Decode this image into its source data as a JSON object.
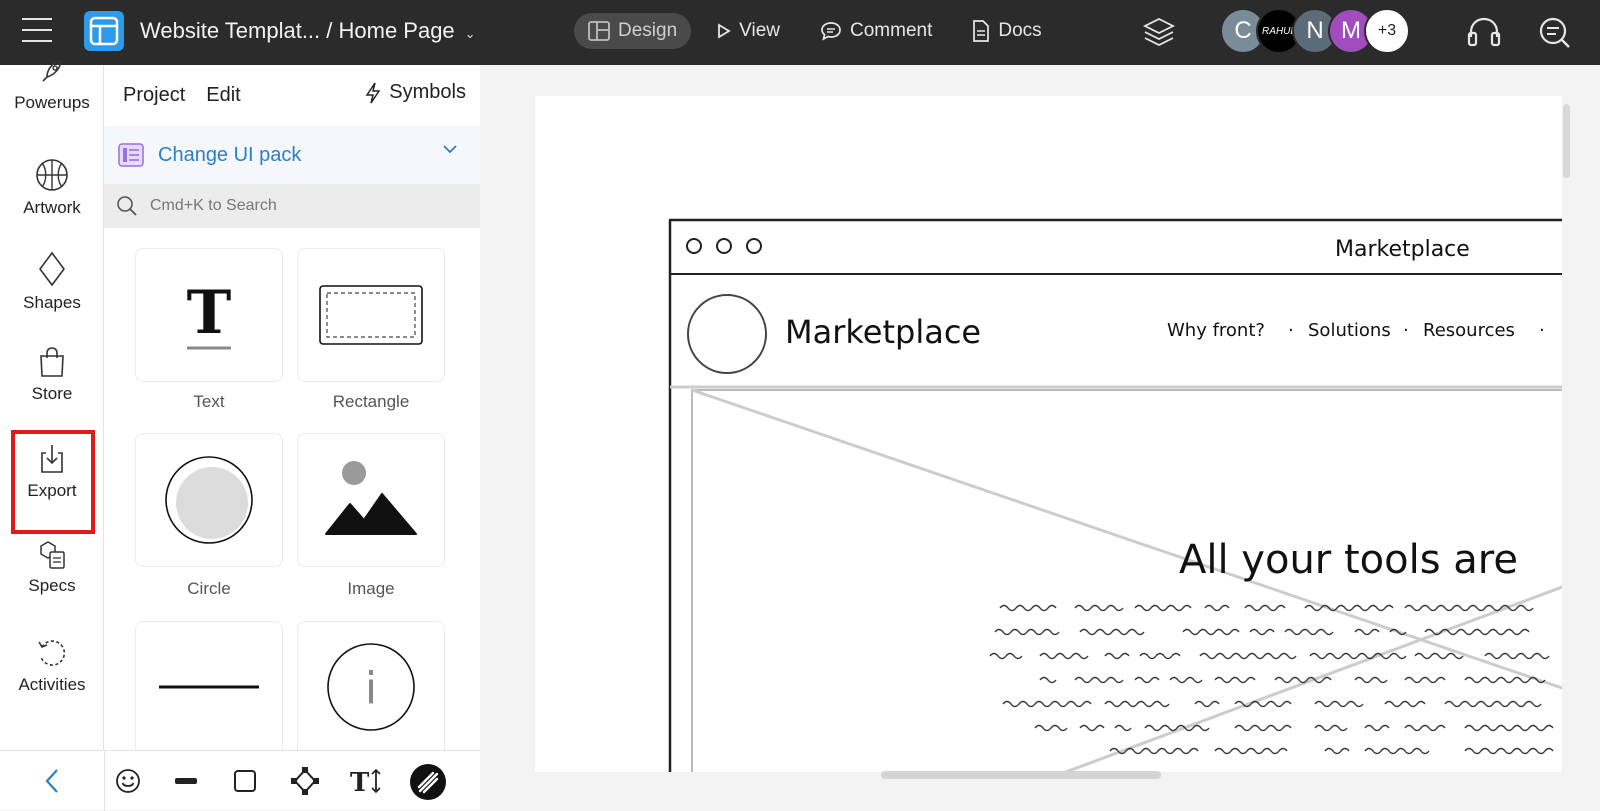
{
  "topbar": {
    "title": "Website Templat... / Home Page",
    "tabs": [
      {
        "label": "Design",
        "icon": "layout-icon",
        "active": true
      },
      {
        "label": "View",
        "icon": "play-icon",
        "active": false
      },
      {
        "label": "Comment",
        "icon": "comment-icon",
        "active": false
      },
      {
        "label": "Docs",
        "icon": "document-icon",
        "active": false
      }
    ],
    "avatars": [
      {
        "initial": "C",
        "color": "#7a8c98"
      },
      {
        "initial": "RAHUL",
        "color": "#000000"
      },
      {
        "initial": "N",
        "color": "#5b6b78"
      },
      {
        "initial": "M",
        "color": "#a24dbf"
      },
      {
        "initial": "+3",
        "color": "#ffffff"
      }
    ]
  },
  "rail": {
    "items": [
      {
        "label": "Powerups",
        "icon": "rocket-icon"
      },
      {
        "label": "Artwork",
        "icon": "basketball-icon"
      },
      {
        "label": "Shapes",
        "icon": "diamond-icon"
      },
      {
        "label": "Store",
        "icon": "shopping-bag-icon"
      },
      {
        "label": "Export",
        "icon": "download-icon",
        "highlighted": true
      },
      {
        "label": "Specs",
        "icon": "specs-icon"
      },
      {
        "label": "Activities",
        "icon": "history-icon"
      }
    ]
  },
  "panel": {
    "menu": [
      "Project",
      "Edit"
    ],
    "symbols_label": "Symbols",
    "ui_pack_label": "Change UI pack",
    "search_placeholder": "Cmd+K to Search",
    "tiles": [
      {
        "label": "Text",
        "glyph": "T"
      },
      {
        "label": "Rectangle"
      },
      {
        "label": "Circle"
      },
      {
        "label": "Image"
      },
      {
        "label": ""
      },
      {
        "label": "",
        "glyph": "i"
      }
    ]
  },
  "canvas": {
    "window_title": "Marketplace",
    "brand": "Marketplace",
    "nav": [
      "Why front?",
      "·",
      "Solutions",
      "·",
      "Resources",
      "·"
    ],
    "headline": "All your tools are"
  },
  "colors": {
    "topbar": "#2b2b2b",
    "accent": "#2b7fc4",
    "highlight": "#e01919"
  }
}
